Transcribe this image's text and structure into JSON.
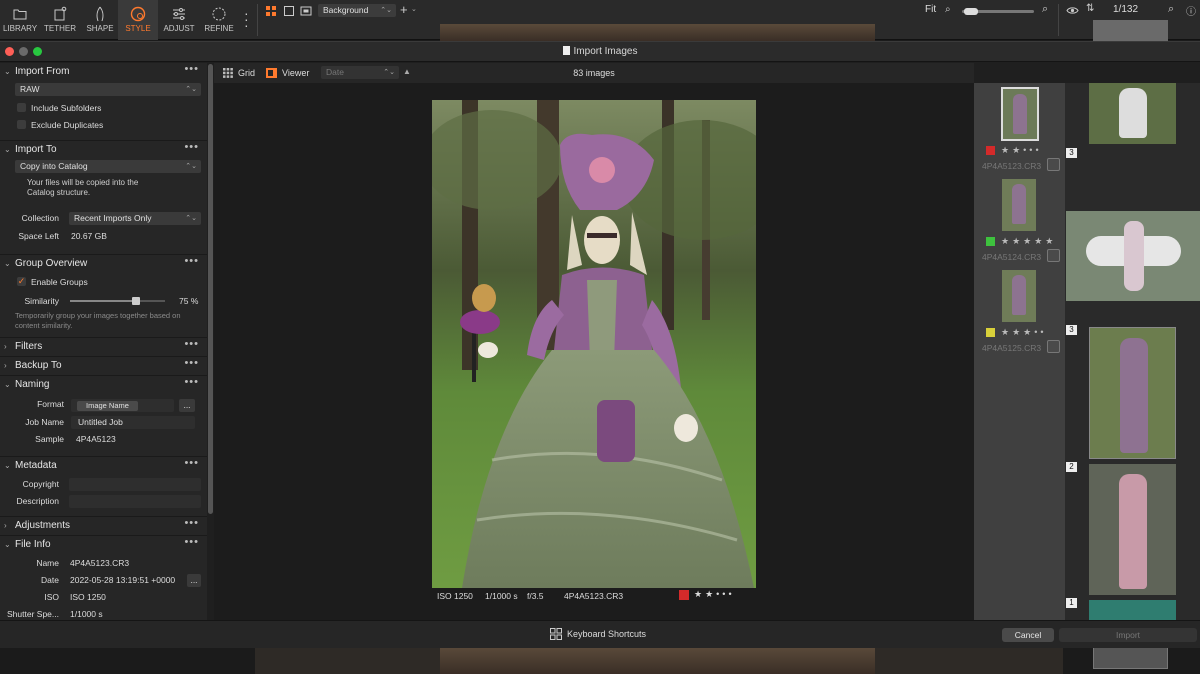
{
  "toolbar": {
    "tools": [
      {
        "name": "library",
        "label": "LIBRARY"
      },
      {
        "name": "tether",
        "label": "TETHER"
      },
      {
        "name": "shape",
        "label": "SHAPE"
      },
      {
        "name": "style",
        "label": "STYLE"
      },
      {
        "name": "adjust",
        "label": "ADJUST"
      },
      {
        "name": "refine",
        "label": "REFINE"
      }
    ],
    "active_tool": "STYLE",
    "background_select": "Background",
    "zoom_label": "Fit",
    "counter": "1/132"
  },
  "dialog": {
    "title": "Import Images",
    "import_from": {
      "header": "Import From",
      "source": "RAW",
      "include_subfolders": "Include Subfolders",
      "exclude_duplicates": "Exclude Duplicates"
    },
    "import_to": {
      "header": "Import To",
      "destination": "Copy into Catalog",
      "note": "Your files will be copied into the Catalog structure.",
      "collection_label": "Collection",
      "collection_value": "Recent Imports Only",
      "space_label": "Space Left",
      "space_value": "20.67 GB"
    },
    "group_overview": {
      "header": "Group Overview",
      "enable_groups": "Enable Groups",
      "similarity_label": "Similarity",
      "similarity_value": "75",
      "similarity_unit": "%",
      "hint": "Temporarily group your images together based on content similarity."
    },
    "filters": {
      "header": "Filters"
    },
    "backup_to": {
      "header": "Backup To"
    },
    "naming": {
      "header": "Naming",
      "format_label": "Format",
      "format_token": "Image Name",
      "format_more": "...",
      "job_label": "Job Name",
      "job_value": "Untitled Job",
      "sample_label": "Sample",
      "sample_value": "4P4A5123"
    },
    "metadata": {
      "header": "Metadata",
      "copyright_label": "Copyright",
      "description_label": "Description"
    },
    "adjustments": {
      "header": "Adjustments"
    },
    "file_info": {
      "header": "File Info",
      "name_label": "Name",
      "name_value": "4P4A5123.CR3",
      "date_label": "Date",
      "date_value": "2022-05-28 13:19:51 +0000",
      "date_more": "...",
      "iso_label": "ISO",
      "iso_value": "ISO 1250",
      "shutter_label": "Shutter Spe...",
      "shutter_value": "1/1000 s"
    },
    "viewer_bar": {
      "grid_label": "Grid",
      "viewer_label": "Viewer",
      "sort_value": "Date",
      "image_count": "83 images"
    },
    "caption": {
      "iso": "ISO 1250",
      "shutter": "1/1000 s",
      "aperture": "f/3.5",
      "filename": "4P4A5123.CR3",
      "rating": 2,
      "color_tag": "#d42a2a"
    },
    "thumbnails": [
      {
        "file": "4P4A5123.CR3",
        "rating": 2,
        "color": "#d42a2a"
      },
      {
        "file": "4P4A5124.CR3",
        "rating": 5,
        "color": "#3ec23e"
      },
      {
        "file": "4P4A5125.CR3",
        "rating": 3,
        "color": "#d8d03a"
      }
    ],
    "film_badges": [
      "3",
      "3",
      "2",
      "1"
    ],
    "footer": {
      "shortcuts_label": "Keyboard Shortcuts",
      "cancel_label": "Cancel",
      "import_label": "Import"
    }
  }
}
